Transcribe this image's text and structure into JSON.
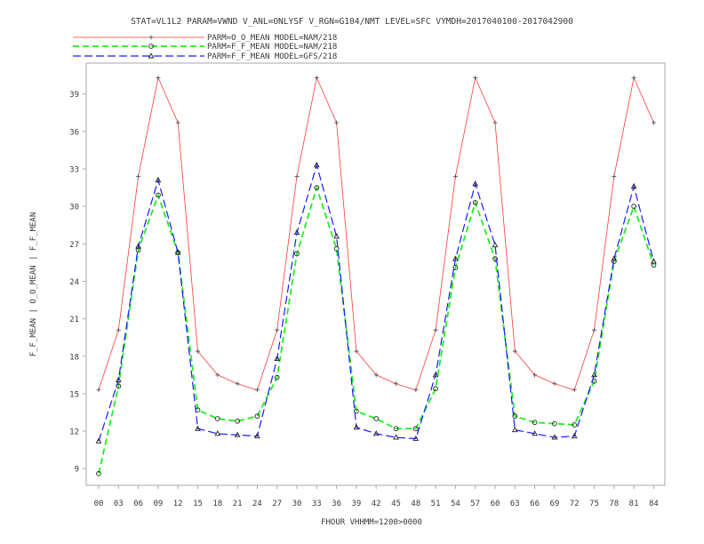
{
  "chart_data": {
    "type": "line",
    "title": "STAT=VL1L2 PARAM=VWND V_ANL=ONLYSF V_RGN=G104/NMT LEVEL=SFC VYMDH=2017040100-2017042900",
    "xlabel": "FHOUR VHHMM=1200>0000",
    "ylabel": "F_F_MEAN | O_O_MEAN | F_F_MEAN",
    "categories": [
      "00",
      "03",
      "06",
      "09",
      "12",
      "15",
      "18",
      "21",
      "24",
      "27",
      "30",
      "33",
      "36",
      "39",
      "42",
      "45",
      "48",
      "51",
      "54",
      "57",
      "60",
      "63",
      "66",
      "69",
      "72",
      "75",
      "78",
      "81",
      "84"
    ],
    "yticks": [
      "9",
      "12",
      "15",
      "18",
      "21",
      "24",
      "27",
      "30",
      "33",
      "36",
      "39"
    ],
    "ylim": [
      7.5,
      41.5
    ],
    "grid": false,
    "legend_position": "top-left",
    "series": [
      {
        "name": "PARM=O_O_MEAN MODEL=NAM/218",
        "color": "#ff3a3a",
        "dash": "solid",
        "marker": "plus",
        "values": [
          15.3,
          20.1,
          32.4,
          40.3,
          36.7,
          18.4,
          16.5,
          15.8,
          15.3,
          20.1,
          32.4,
          40.3,
          36.7,
          18.4,
          16.5,
          15.8,
          15.3,
          20.1,
          32.4,
          40.3,
          36.7,
          18.4,
          16.5,
          15.8,
          15.3,
          20.1,
          32.4,
          40.3,
          36.7
        ]
      },
      {
        "name": "PARM=F_F_MEAN MODEL=NAM/218",
        "color": "#22ee22",
        "dash": "dashed",
        "marker": "circle",
        "values": [
          8.6,
          15.6,
          26.5,
          30.9,
          26.3,
          13.7,
          13.0,
          12.8,
          13.2,
          16.3,
          26.2,
          31.5,
          26.6,
          13.6,
          13.0,
          12.2,
          12.2,
          15.4,
          25.1,
          30.3,
          25.8,
          13.2,
          12.7,
          12.6,
          12.5,
          16.0,
          25.6,
          30.0,
          25.3
        ]
      },
      {
        "name": "PARM=F_F_MEAN MODEL=GFS/218",
        "color": "#1a1aff",
        "dash": "dashed",
        "marker": "triangle",
        "values": [
          11.2,
          16.1,
          26.8,
          32.1,
          26.3,
          12.2,
          11.8,
          11.7,
          11.6,
          17.8,
          27.9,
          33.3,
          27.6,
          12.3,
          11.8,
          11.5,
          11.4,
          16.5,
          25.8,
          31.8,
          26.9,
          12.1,
          11.8,
          11.5,
          11.6,
          16.5,
          25.8,
          31.6,
          25.6
        ]
      }
    ]
  }
}
